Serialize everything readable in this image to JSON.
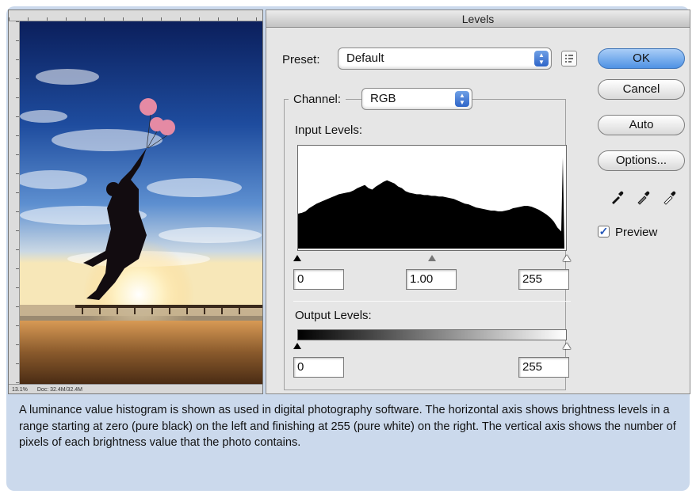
{
  "photo_window": {
    "status_zoom": "13.1%",
    "status_doc": "Doc: 32.4M/32.4M"
  },
  "dialog": {
    "title": "Levels",
    "preset_label": "Preset:",
    "preset_value": "Default",
    "channel_label": "Channel:",
    "channel_value": "RGB",
    "input_levels_label": "Input Levels:",
    "input_black": "0",
    "input_gamma": "1.00",
    "input_white": "255",
    "output_levels_label": "Output Levels:",
    "output_black": "0",
    "output_white": "255",
    "buttons": {
      "ok": "OK",
      "cancel": "Cancel",
      "auto": "Auto",
      "options": "Options..."
    },
    "preview_label": "Preview",
    "preview_checked": true
  },
  "histogram_data": [
    0.45,
    0.46,
    0.48,
    0.52,
    0.55,
    0.58,
    0.6,
    0.62,
    0.64,
    0.66,
    0.68,
    0.7,
    0.71,
    0.72,
    0.73,
    0.75,
    0.78,
    0.8,
    0.82,
    0.78,
    0.76,
    0.8,
    0.83,
    0.86,
    0.88,
    0.86,
    0.84,
    0.8,
    0.78,
    0.74,
    0.72,
    0.71,
    0.7,
    0.7,
    0.69,
    0.69,
    0.68,
    0.68,
    0.67,
    0.67,
    0.66,
    0.65,
    0.64,
    0.62,
    0.6,
    0.58,
    0.57,
    0.55,
    0.53,
    0.52,
    0.51,
    0.5,
    0.49,
    0.49,
    0.48,
    0.48,
    0.49,
    0.5,
    0.52,
    0.53,
    0.54,
    0.55,
    0.55,
    0.54,
    0.52,
    0.5,
    0.47,
    0.44,
    0.4,
    0.35,
    0.27,
    0.22
  ],
  "colors": {
    "frame_bg": "#cbd9ec",
    "dialog_bg": "#e6e6e6",
    "primary_button": "#4f92e4"
  },
  "caption": "A luminance value histogram is shown as used in digital photography software. The horizontal axis shows brightness levels in a range starting at zero (pure black) on the left and finishing at 255 (pure white) on the right. The vertical axis shows the number of pixels of each brightness value that the photo contains."
}
